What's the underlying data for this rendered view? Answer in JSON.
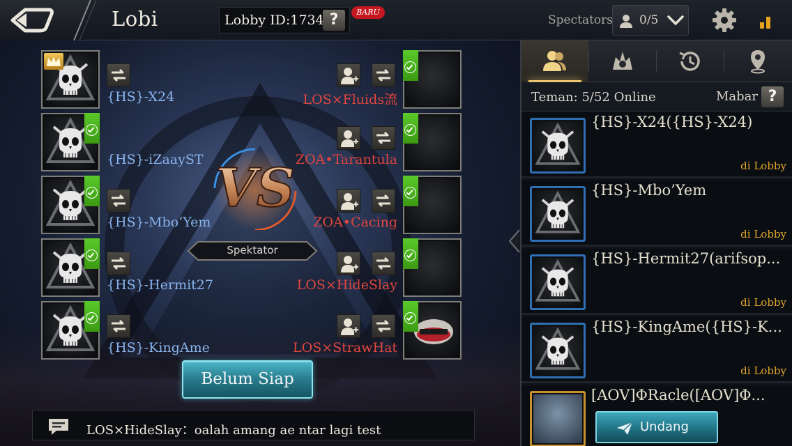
{
  "header": {
    "title": "Lobi",
    "lobby_id": "Lobby ID:1734",
    "help_glyph": "?",
    "new_badge": "BARU",
    "spectators_label": "Spectators",
    "spectators_count": "0/5"
  },
  "team_left": [
    {
      "name": "{HS}-X24",
      "ready": false,
      "host": true
    },
    {
      "name": "{HS}-iZaayST",
      "ready": true,
      "host": false
    },
    {
      "name": "{HS}-Mbo’Yem",
      "ready": true,
      "host": false
    },
    {
      "name": "{HS}-Hermit27",
      "ready": true,
      "host": false
    },
    {
      "name": "{HS}-KingAme",
      "ready": true,
      "host": false
    }
  ],
  "team_right": [
    {
      "name": "LOS×Fluids流",
      "ready": true
    },
    {
      "name": "ZOA•Tarantula",
      "ready": true
    },
    {
      "name": "ZOA•Cacing",
      "ready": true
    },
    {
      "name": "LOS×HideSlay",
      "ready": true
    },
    {
      "name": "LOS×StrawHat",
      "ready": true
    }
  ],
  "center": {
    "vs_text": "VS",
    "spectator_button": "Spektator",
    "ready_button": "Belum Siap"
  },
  "chat": {
    "message": "LOS×HideSlay：oalah amang ae ntar lagi test"
  },
  "panel": {
    "tabs": [
      "friends-icon",
      "guild-icon",
      "history-icon",
      "location-icon"
    ],
    "friends_count": "Teman: 5/52 Online",
    "mabar_label": "Mabar",
    "help_glyph": "?",
    "friends": [
      {
        "name": "{HS}-X24({HS}-X24)",
        "status": "di Lobby"
      },
      {
        "name": "{HS}-Mbo’Yem",
        "status": "di Lobby"
      },
      {
        "name": "{HS}-Hermit27(arifsop...",
        "status": "di Lobby"
      },
      {
        "name": "{HS}-KingAme({HS}-K...",
        "status": "di Lobby"
      },
      {
        "name": "[AOV]ΦRacle([AOV]Φ...",
        "status": ""
      }
    ],
    "invite_button": "Undang"
  },
  "colors": {
    "ally_name": "#8ab4ee",
    "enemy_name": "#e0453f",
    "ready_check": "#4bb51e",
    "status_text": "#e0a62c",
    "accent_gold": "#e7c46d"
  }
}
